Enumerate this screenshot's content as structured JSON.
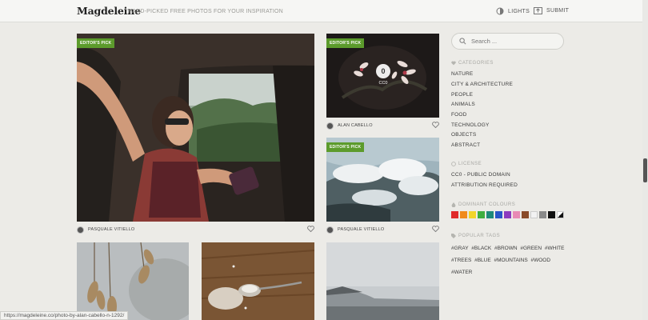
{
  "header": {
    "logo": "Magdeleine",
    "tagline": "HAND-PICKED FREE PHOTOS FOR YOUR INSPIRATION",
    "lights_label": "LIGHTS",
    "submit_label": "SUBMIT"
  },
  "photos": [
    {
      "badge": "EDITOR'S PICK",
      "author": "PASQUALE VITIELLO"
    },
    {
      "badge": "EDITOR'S PICK",
      "author": "ALAN CABELLO",
      "license_mark": "0",
      "license_label": "CC0"
    },
    {
      "badge": "EDITOR'S PICK",
      "author": "PASQUALE VITIELLO"
    }
  ],
  "sidebar": {
    "search_placeholder": "Search ...",
    "categories_title": "CATEGORIES",
    "categories": [
      "NATURE",
      "CITY & ARCHITECTURE",
      "PEOPLE",
      "ANIMALS",
      "FOOD",
      "TECHNOLOGY",
      "OBJECTS",
      "ABSTRACT"
    ],
    "license_title": "LICENSE",
    "licenses": [
      "CC0 - PUBLIC DOMAIN",
      "ATTRIBUTION REQUIRED"
    ],
    "colours_title": "DOMINANT COLOURS",
    "colours": [
      "#e02a2a",
      "#f08a1c",
      "#f2d52a",
      "#3fae3f",
      "#1f8a7a",
      "#2a56c9",
      "#8c3bbf",
      "#e88ab5",
      "#8a4b2a",
      "#f2f2f2",
      "#8a8a8a",
      "#111111",
      "#bw-split"
    ],
    "tags_title": "POPULAR TAGS",
    "tags": [
      "#GRAY",
      "#BLACK",
      "#BROWN",
      "#GREEN",
      "#WHITE",
      "#TREES",
      "#BLUE",
      "#MOUNTAINS",
      "#WOOD",
      "#WATER"
    ]
  },
  "statusbar": {
    "url": "https://magdeleine.co/photo-by-alan-cabello-n-1292/"
  }
}
